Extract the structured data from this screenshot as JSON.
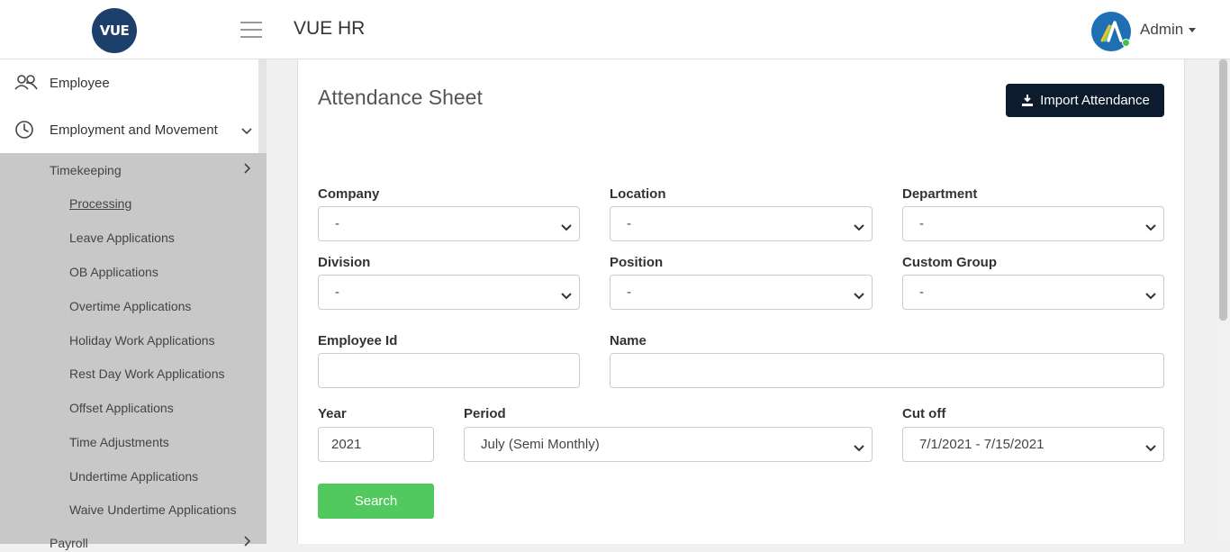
{
  "header": {
    "logo_text": "VUE",
    "app_title": "VUE HR",
    "user_name": "Admin"
  },
  "sidebar": {
    "items": [
      {
        "label": "Employee",
        "icon": "users-icon"
      },
      {
        "label": "Employment and Movement",
        "icon": "clock-icon"
      }
    ],
    "timekeeping": {
      "label": "Timekeeping",
      "children": [
        "Processing",
        "Leave Applications",
        "OB Applications",
        "Overtime Applications",
        "Holiday Work Applications",
        "Rest Day Work Applications",
        "Offset Applications",
        "Time Adjustments",
        "Undertime Applications",
        "Waive Undertime Applications"
      ]
    },
    "payroll_label": "Payroll"
  },
  "main": {
    "title": "Attendance Sheet",
    "import_button": "Import Attendance",
    "fields": {
      "company": {
        "label": "Company",
        "value": "-"
      },
      "location": {
        "label": "Location",
        "value": "-"
      },
      "department": {
        "label": "Department",
        "value": "-"
      },
      "division": {
        "label": "Division",
        "value": "-"
      },
      "position": {
        "label": "Position",
        "value": "-"
      },
      "custom_group": {
        "label": "Custom Group",
        "value": "-"
      },
      "employee_id": {
        "label": "Employee Id",
        "value": ""
      },
      "name": {
        "label": "Name",
        "value": ""
      },
      "year": {
        "label": "Year",
        "value": "2021"
      },
      "period": {
        "label": "Period",
        "value": "July (Semi Monthly)"
      },
      "cutoff": {
        "label": "Cut off",
        "value": "7/1/2021 - 7/15/2021"
      }
    },
    "search_button": "Search"
  }
}
